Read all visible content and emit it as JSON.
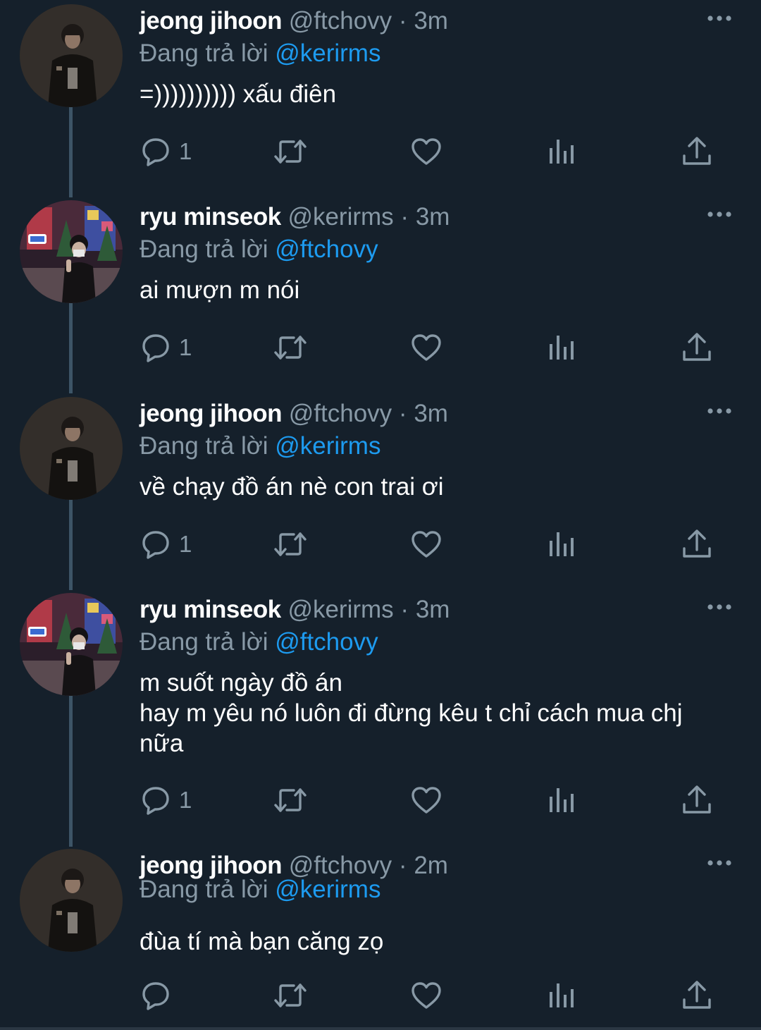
{
  "colors": {
    "background": "#15202b",
    "text_primary": "#ffffff",
    "text_secondary": "#8899a6",
    "mention": "#1d9bf0",
    "thread_line": "#3d5466"
  },
  "tweets": [
    {
      "name": "jeong jihoon",
      "handle": "@ftchovy",
      "separator": "·",
      "time": "3m",
      "reply_prefix": "Đang trả lời",
      "reply_to": "@kerirms",
      "lines": [
        "=)))))))))) xấu điên"
      ],
      "reply_count": "1",
      "avatar": "dark-portrait-avatar"
    },
    {
      "name": "ryu minseok",
      "handle": "@kerirms",
      "separator": "·",
      "time": "3m",
      "reply_prefix": "Đang trả lời",
      "reply_to": "@ftchovy",
      "lines": [
        "ai mượn m nói"
      ],
      "reply_count": "1",
      "avatar": "city-night-avatar"
    },
    {
      "name": "jeong jihoon",
      "handle": "@ftchovy",
      "separator": "·",
      "time": "3m",
      "reply_prefix": "Đang trả lời",
      "reply_to": "@kerirms",
      "lines": [
        "về chạy đồ án nè con trai ơi"
      ],
      "reply_count": "1",
      "avatar": "dark-portrait-avatar"
    },
    {
      "name": "ryu minseok",
      "handle": "@kerirms",
      "separator": "·",
      "time": "3m",
      "reply_prefix": "Đang trả lời",
      "reply_to": "@ftchovy",
      "lines": [
        "m suốt ngày đồ án",
        "hay m yêu nó luôn đi đừng kêu t chỉ cách mua chj",
        "nữa"
      ],
      "reply_count": "1",
      "avatar": "city-night-avatar"
    },
    {
      "name": "jeong jihoon",
      "handle": "@ftchovy",
      "separator": "·",
      "time": "2m",
      "reply_prefix": "Đang trả lời",
      "reply_to": "@kerirms",
      "lines": [
        "đùa tí mà bạn căng zọ"
      ],
      "reply_count": "",
      "avatar": "dark-portrait-avatar"
    }
  ],
  "icons": {
    "reply": "reply-bubble-icon",
    "retweet": "retweet-arrows-icon",
    "like": "heart-icon",
    "views": "analytics-bars-icon",
    "share": "share-upload-icon",
    "more": "more-dots-icon"
  }
}
